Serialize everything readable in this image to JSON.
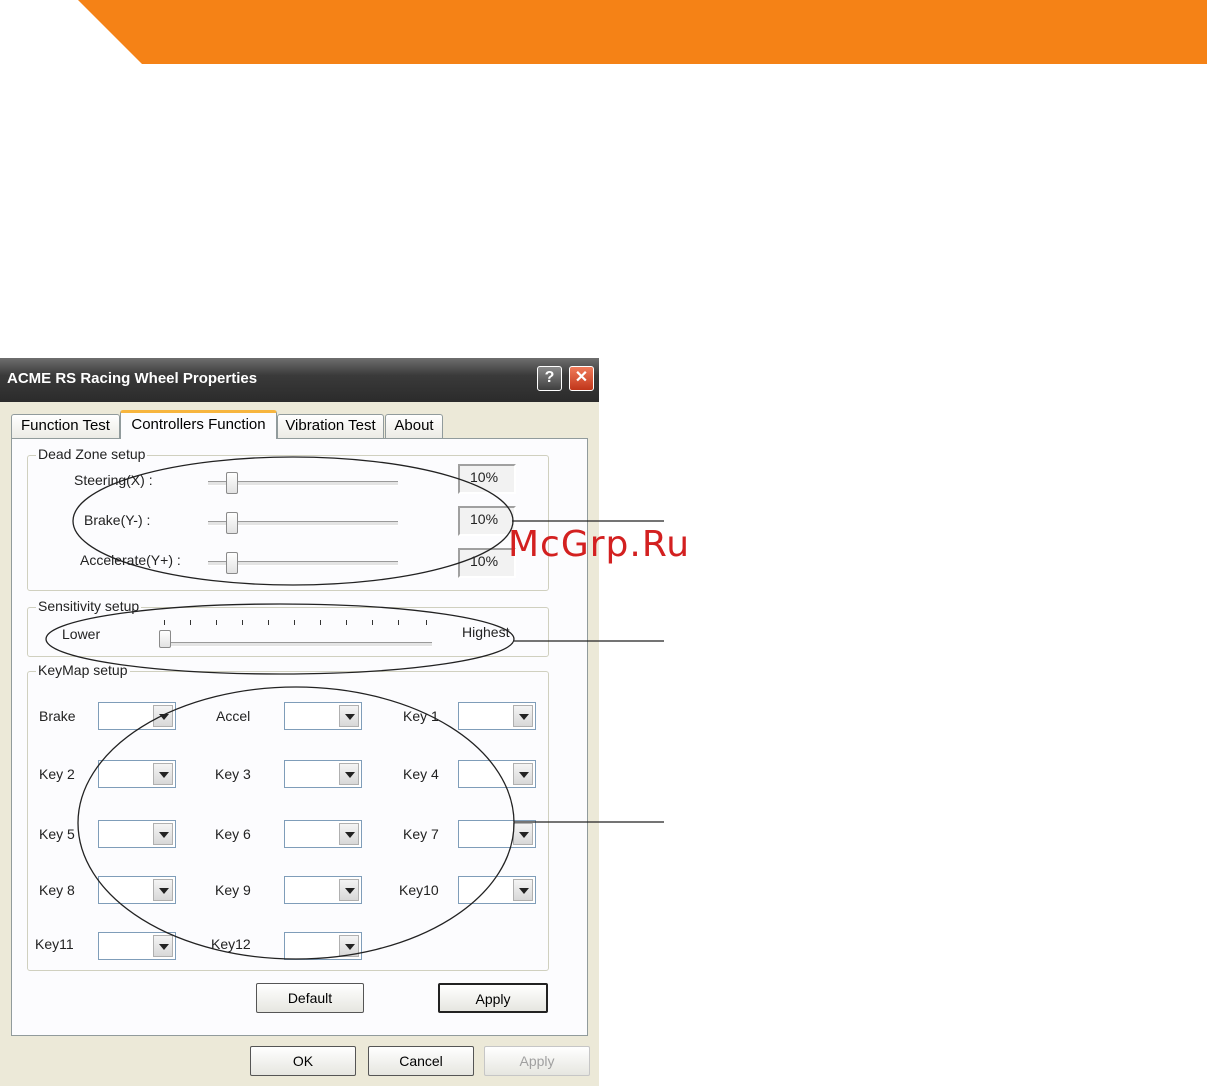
{
  "colors": {
    "banner": "#f58216",
    "accent_tab": "#f7b53e",
    "watermark": "#d32020"
  },
  "dialog": {
    "title": "ACME RS Racing Wheel Properties",
    "help_label": "?",
    "close_label": "✕",
    "tabs": [
      {
        "label": "Function Test",
        "active": false
      },
      {
        "label": "Controllers Function",
        "active": true
      },
      {
        "label": "Vibration Test",
        "active": false
      },
      {
        "label": "About",
        "active": false
      }
    ]
  },
  "dead_zone": {
    "title": "Dead Zone setup",
    "rows": [
      {
        "label": "Steering(X) :",
        "value": "10%"
      },
      {
        "label": "Brake(Y-) :",
        "value": "10%"
      },
      {
        "label": "Accelerate(Y+) :",
        "value": "10%"
      }
    ]
  },
  "sensitivity": {
    "title": "Sensitivity setup",
    "low_label": "Lower",
    "high_label": "Highest"
  },
  "keymap": {
    "title": "KeyMap setup",
    "items": [
      "Brake",
      "Accel",
      "Key 1",
      "Key 2",
      "Key 3",
      "Key 4",
      "Key 5",
      "Key 6",
      "Key 7",
      "Key 8",
      "Key 9",
      "Key10",
      "Key11",
      "Key12"
    ]
  },
  "panel_buttons": {
    "default_label": "Default",
    "apply_label": "Apply"
  },
  "footer_buttons": {
    "ok_label": "OK",
    "cancel_label": "Cancel",
    "apply_label": "Apply"
  },
  "watermark": {
    "text": "McGrp.Ru"
  }
}
